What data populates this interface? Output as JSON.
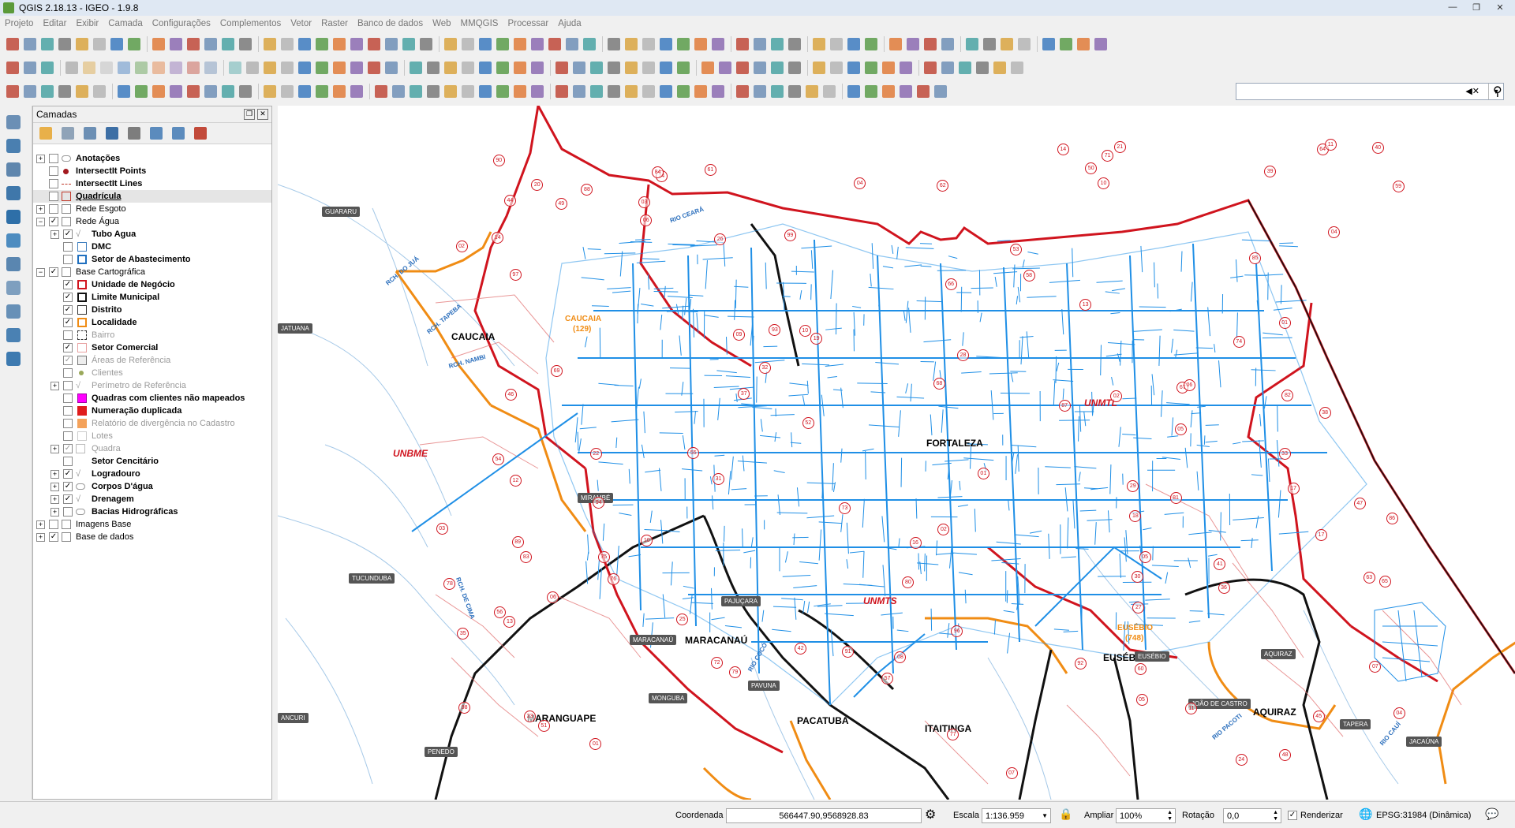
{
  "window": {
    "title": "QGIS 2.18.13 - IGEO - 1.9.8",
    "controls": [
      "—",
      "❐",
      "✕"
    ]
  },
  "menu": [
    "Projeto",
    "Editar",
    "Exibir",
    "Camada",
    "Configurações",
    "Complementos",
    "Vetor",
    "Raster",
    "Banco de dados",
    "Web",
    "MMQGIS",
    "Processar",
    "Ajuda"
  ],
  "layers_panel": {
    "title": "Camadas",
    "items": [
      {
        "label": "Anotações"
      },
      {
        "label": "IntersectIt Points"
      },
      {
        "label": "IntersectIt Lines"
      },
      {
        "label": "Quadrícula"
      },
      {
        "label": "Rede Esgoto"
      },
      {
        "label": "Rede Água"
      },
      {
        "label": "Tubo Agua"
      },
      {
        "label": "DMC"
      },
      {
        "label": "Setor de Abastecimento"
      },
      {
        "label": "Base Cartográfica"
      },
      {
        "label": "Unidade de Negócio"
      },
      {
        "label": "Limite Municipal"
      },
      {
        "label": "Distrito"
      },
      {
        "label": "Localidade"
      },
      {
        "label": "Bairro"
      },
      {
        "label": "Setor Comercial"
      },
      {
        "label": "Áreas de Referência"
      },
      {
        "label": "Clientes"
      },
      {
        "label": "Perímetro de Referência"
      },
      {
        "label": "Quadras com clientes não mapeados"
      },
      {
        "label": "Numeração duplicada"
      },
      {
        "label": "Relatório de divergência no Cadastro"
      },
      {
        "label": "Lotes"
      },
      {
        "label": "Quadra"
      },
      {
        "label": "Setor Cencitário"
      },
      {
        "label": "Logradouro"
      },
      {
        "label": "Corpos D'água"
      },
      {
        "label": "Drenagem"
      },
      {
        "label": "Bacias Hidrográficas"
      },
      {
        "label": "Imagens Base"
      },
      {
        "label": "Base de dados"
      }
    ]
  },
  "map_labels": {
    "cities": [
      "CAUCAIA",
      "FORTALEZA",
      "MARACANAÚ",
      "MARANGUAPE",
      "PACATUBA",
      "ITAITINGA",
      "EUSÉBIO",
      "AQUIRAZ"
    ],
    "units": [
      "UNMTL",
      "UNBME",
      "UNMTS"
    ],
    "localities": [
      "CAUCAIA",
      "(129)",
      "EUSÉBIO",
      "(748)"
    ],
    "chips": [
      "GUARARU",
      "TUCUNDUBA",
      "MIRAMBÉ",
      "PAJUÇARA",
      "MARACANAÚ",
      "MONGUBA",
      "PAVUNA",
      "EUSÉBIO",
      "AQUIRAZ",
      "JOÃO DE CASTRO",
      "TAPERA",
      "JACAÚNA",
      "PENEDO",
      "JATUANA",
      "ANCURI"
    ],
    "rivers": [
      "RCH. DO JUÁ",
      "RCH. TAPEBA",
      "RCH. NAMBI",
      "RIO CEARÁ",
      "RIO COCÓ",
      "RIO PACOTI",
      "RCH. DE CIMA",
      "RIO CAUÍ"
    ],
    "sector_numbers": [
      "18",
      "17",
      "23",
      "24",
      "19",
      "11",
      "13",
      "10",
      "09",
      "07",
      "14",
      "54",
      "44",
      "45",
      "42",
      "38",
      "16",
      "01",
      "10",
      "76",
      "40",
      "39",
      "37",
      "17",
      "14",
      "03",
      "05",
      "12",
      "06",
      "05",
      "77",
      "92",
      "32",
      "31",
      "33",
      "36",
      "30",
      "22",
      "08",
      "06",
      "04",
      "21",
      "48",
      "91",
      "41",
      "25",
      "35",
      "20",
      "87",
      "46",
      "86",
      "93",
      "64",
      "29",
      "27",
      "24",
      "13",
      "90",
      "94",
      "88",
      "81",
      "26",
      "28",
      "89",
      "62",
      "69",
      "73",
      "75",
      "55",
      "56",
      "58",
      "61",
      "52",
      "49",
      "68",
      "71",
      "83",
      "72",
      "79",
      "85",
      "63",
      "53",
      "50",
      "74",
      "82",
      "47",
      "84",
      "57",
      "59",
      "66",
      "60",
      "51",
      "02",
      "65",
      "02",
      "97",
      "96",
      "98",
      "78",
      "67",
      "80",
      "01",
      "04",
      "99",
      "01",
      "02",
      "03",
      "04",
      "05",
      "06",
      "10",
      "11",
      "07"
    ]
  },
  "status": {
    "coord_label": "Coordenada",
    "coord_value": "566447.90,9568928.83",
    "scale_label": "Escala",
    "scale_value": "1:136.959",
    "zoom_label": "Ampliar",
    "zoom_value": "100%",
    "rotation_label": "Rotação",
    "rotation_value": "0,0",
    "render_label": "Renderizar",
    "crs": "EPSG:31984 (Dinâmica)"
  }
}
